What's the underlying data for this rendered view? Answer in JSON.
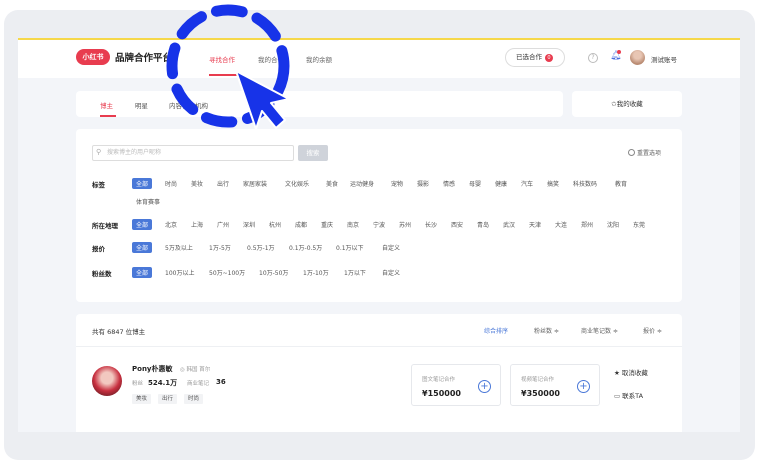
{
  "header": {
    "logo_text": "小红书",
    "title": "品牌合作平台",
    "nav": [
      {
        "label": "寻找合作"
      },
      {
        "label": "我的合作"
      },
      {
        "label": "我的余额"
      }
    ],
    "coop_button": "已选合作",
    "coop_count": "0",
    "help_icon": "question-circle-icon",
    "bell_icon": "bell-icon",
    "account_name": "测试账号"
  },
  "tabs": [
    {
      "label": "博主"
    },
    {
      "label": "明星"
    },
    {
      "label": "内容合作机构"
    }
  ],
  "favorites_label": "✩我的收藏",
  "search": {
    "placeholder": "搜索博主的用户昵称",
    "button": "搜索",
    "reset": "重置选项"
  },
  "filters": {
    "tags": {
      "label": "标签",
      "options": [
        "全部",
        "时尚",
        "美妆",
        "出行",
        "家居家装",
        "文化娱乐",
        "美食",
        "运动健身",
        "宠物",
        "摄影",
        "情感",
        "母婴",
        "健康",
        "汽车",
        "搞笑",
        "科技数码",
        "教育",
        "体育赛事"
      ]
    },
    "region": {
      "label": "所在地理",
      "options": [
        "全部",
        "北京",
        "上海",
        "广州",
        "深圳",
        "杭州",
        "成都",
        "重庆",
        "南京",
        "宁波",
        "苏州",
        "长沙",
        "西安",
        "青岛",
        "武汉",
        "天津",
        "大连",
        "郑州",
        "沈阳",
        "东莞"
      ]
    },
    "price": {
      "label": "报价",
      "options": [
        "全部",
        "5万及以上",
        "1万-5万",
        "0.5万-1万",
        "0.1万-0.5万",
        "0.1万以下",
        "自定义"
      ]
    },
    "fans": {
      "label": "粉丝数",
      "options": [
        "全部",
        "100万以上",
        "50万~100万",
        "10万-50万",
        "1万-10万",
        "1万以下",
        "自定义"
      ]
    }
  },
  "list": {
    "total": "共有 6847 位博主",
    "sorts": [
      "综合排序",
      "粉丝数 ≑",
      "商业笔记数 ≑",
      "报价 ≑"
    ],
    "blogger": {
      "name": "Pony朴惠敏",
      "location": "◎ 韩国 首尔",
      "fans_label": "粉丝",
      "fans_value": "524.1万",
      "notes_label": "商业笔记",
      "notes_value": "36",
      "tags": [
        "美妆",
        "出行",
        "时尚"
      ],
      "prices": [
        {
          "type": "图文笔记合作",
          "value": "¥150000"
        },
        {
          "type": "视频笔记合作",
          "value": "¥350000"
        }
      ],
      "action_fav": "取消收藏",
      "action_chat": "联系TA"
    }
  },
  "colors": {
    "brand_red": "#e83c4f",
    "accent_blue": "#4a78d8",
    "overlay_blue": "#1733e8"
  }
}
